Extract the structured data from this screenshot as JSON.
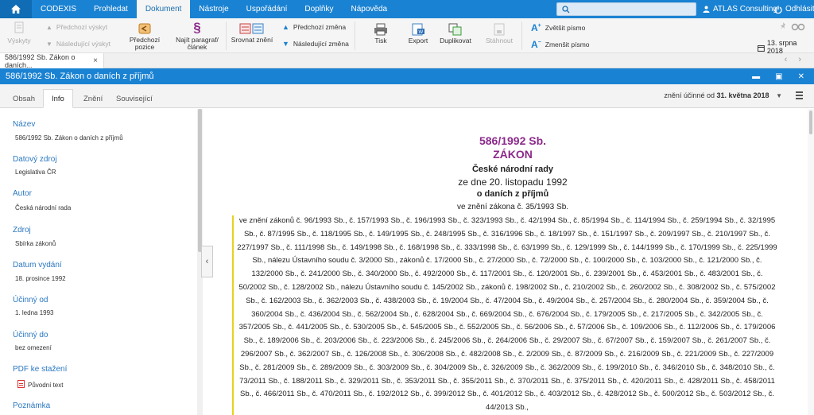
{
  "menubar": {
    "items": [
      "CODEXIS",
      "Prohledat",
      "Dokument",
      "Nástroje",
      "Uspořádání",
      "Doplňky",
      "Nápověda"
    ],
    "active": "Dokument",
    "user": "ATLAS Consulting",
    "logout": "Odhlásit"
  },
  "toolbar": {
    "vyskyty": "Výskyty",
    "predchozi_vyskyt": "Předchozí výskyt",
    "nasledujici_vyskyt": "Následující výskyt",
    "predchozi_pozice": "Předchozí pozice",
    "najit_paragraf": "Najít paragraf/článek",
    "srovnat_zneni": "Srovnat znění",
    "predchozi_zmena": "Předchozí změna",
    "nasledujici_zmena": "Následující změna",
    "tisk": "Tisk",
    "export": "Export",
    "duplikovat": "Duplikovat",
    "stahnout": "Stáhnout",
    "zvetsit_pismo": "Zvětšit písmo",
    "zmensit_pismo": "Zmenšit písmo",
    "date": "13. srpna 2018"
  },
  "tabstrip": {
    "doc_tab": "586/1992 Sb. Zákon o daních...",
    "close": "×"
  },
  "titlebar": {
    "title": "586/1992 Sb. Zákon o daních z příjmů"
  },
  "subtabs": {
    "items": [
      "Obsah",
      "Info",
      "Znění",
      "Související"
    ],
    "active": "Info",
    "effective_prefix": "znění účinné od",
    "effective_date": "31. května 2018"
  },
  "info": {
    "nazev_label": "Název",
    "nazev": "586/1992 Sb. Zákon o daních z příjmů",
    "zdroj_dat_label": "Datový zdroj",
    "zdroj_dat": "Legislativa ČR",
    "autor_label": "Autor",
    "autor": "Česká národní rada",
    "zdroj_label": "Zdroj",
    "zdroj": "Sbírka zákonů",
    "vydani_label": "Datum vydání",
    "vydani": "18. prosince 1992",
    "ucinny_od_label": "Účinný od",
    "ucinny_od": "1. ledna 1993",
    "ucinny_do_label": "Účinný do",
    "ucinny_do": "bez omezení",
    "pdf_label": "PDF ke stažení",
    "pdf": "Původní text",
    "poznamka_label": "Poznámka"
  },
  "document": {
    "number": "586/1992 Sb.",
    "type": "ZÁKON",
    "org": "České národní rady",
    "date": "ze dne 20. listopadu 1992",
    "subject": "o daních z příjmů",
    "amend_first": "ve znění zákona č. 35/1993 Sb.",
    "amendments": "ve znění zákonů č. 96/1993 Sb., č. 157/1993 Sb., č. 196/1993 Sb., č. 323/1993 Sb., č. 42/1994 Sb., č. 85/1994 Sb., č. 114/1994 Sb., č. 259/1994 Sb., č. 32/1995 Sb., č. 87/1995 Sb., č. 118/1995 Sb., č. 149/1995 Sb., č. 248/1995 Sb., č. 316/1996 Sb., č. 18/1997 Sb., č. 151/1997 Sb., č. 209/1997 Sb., č. 210/1997 Sb., č. 227/1997 Sb., č. 111/1998 Sb., č. 149/1998 Sb., č. 168/1998 Sb., č. 333/1998 Sb., č. 63/1999 Sb., č. 129/1999 Sb., č. 144/1999 Sb., č. 170/1999 Sb., č. 225/1999 Sb., nálezu Ústavního soudu č. 3/2000 Sb., zákonů č. 17/2000 Sb., č. 27/2000 Sb., č. 72/2000 Sb., č. 100/2000 Sb., č. 103/2000 Sb., č. 121/2000 Sb., č. 132/2000 Sb., č. 241/2000 Sb., č. 340/2000 Sb., č. 492/2000 Sb., č. 117/2001 Sb., č. 120/2001 Sb., č. 239/2001 Sb., č. 453/2001 Sb., č. 483/2001 Sb., č. 50/2002 Sb., č. 128/2002 Sb., nálezu Ústavního soudu č. 145/2002 Sb., zákonů č. 198/2002 Sb., č. 210/2002 Sb., č. 260/2002 Sb., č. 308/2002 Sb., č. 575/2002 Sb., č. 162/2003 Sb., č. 362/2003 Sb., č. 438/2003 Sb., č. 19/2004 Sb., č. 47/2004 Sb., č. 49/2004 Sb., č. 257/2004 Sb., č. 280/2004 Sb., č. 359/2004 Sb., č. 360/2004 Sb., č. 436/2004 Sb., č. 562/2004 Sb., č. 628/2004 Sb., č. 669/2004 Sb., č. 676/2004 Sb., č. 179/2005 Sb., č. 217/2005 Sb., č. 342/2005 Sb., č. 357/2005 Sb., č. 441/2005 Sb., č. 530/2005 Sb., č. 545/2005 Sb., č. 552/2005 Sb., č. 56/2006 Sb., č. 57/2006 Sb., č. 109/2006 Sb., č. 112/2006 Sb., č. 179/2006 Sb., č. 189/2006 Sb., č. 203/2006 Sb., č. 223/2006 Sb., č. 245/2006 Sb., č. 264/2006 Sb., č. 29/2007 Sb., č. 67/2007 Sb., č. 159/2007 Sb., č. 261/2007 Sb., č. 296/2007 Sb., č. 362/2007 Sb., č. 126/2008 Sb., č. 306/2008 Sb., č. 482/2008 Sb., č. 2/2009 Sb., č. 87/2009 Sb., č. 216/2009 Sb., č. 221/2009 Sb., č. 227/2009 Sb., č. 281/2009 Sb., č. 289/2009 Sb., č. 303/2009 Sb., č. 304/2009 Sb., č. 326/2009 Sb., č. 362/2009 Sb., č. 199/2010 Sb., č. 346/2010 Sb., č. 348/2010 Sb., č. 73/2011 Sb., č. 188/2011 Sb., č. 329/2011 Sb., č. 353/2011 Sb., č. 355/2011 Sb., č. 370/2011 Sb., č. 375/2011 Sb., č. 420/2011 Sb., č. 428/2011 Sb., č. 458/2011 Sb., č. 466/2011 Sb., č. 470/2011 Sb., č. 192/2012 Sb., č. 399/2012 Sb., č. 401/2012 Sb., č. 403/2012 Sb., č. 428/2012 Sb., č. 500/2012 Sb., č. 503/2012 Sb., č. 44/2013 Sb.,"
  },
  "colors": {
    "accent": "#1a82d2",
    "title_purple": "#8b2a8a",
    "amend_bar": "#e7d21a",
    "label_blue": "#2b78c1"
  }
}
